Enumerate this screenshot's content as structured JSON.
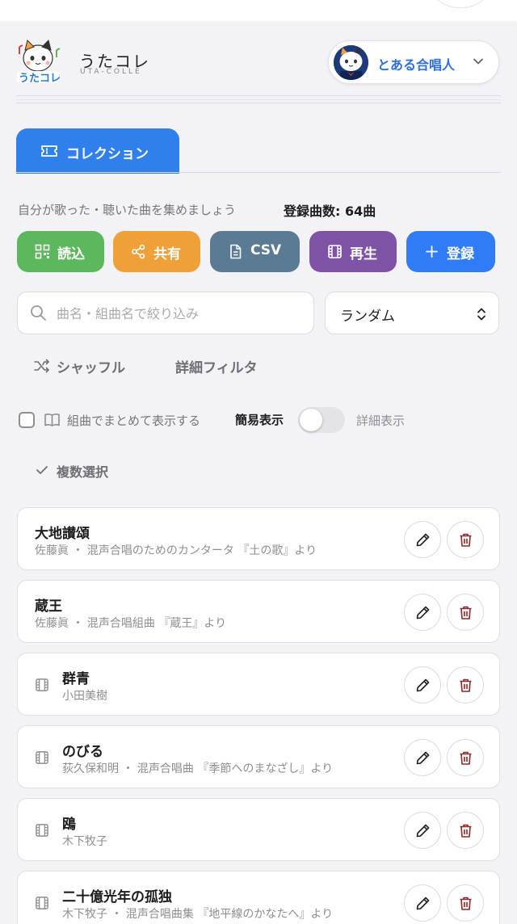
{
  "app": {
    "name": "うたコレ",
    "subtitle": "UTA-COLLE",
    "logo_text": "うたコレ"
  },
  "user": {
    "name": "とある合唱人"
  },
  "tab": {
    "label": "コレクション"
  },
  "intro": {
    "text": "自分が歌った・聴いた曲を集めましょう",
    "count": "登録曲数: 64曲"
  },
  "actions": {
    "read": "読込",
    "share": "共有",
    "csv": "CSV",
    "play": "再生",
    "add": "登録"
  },
  "search": {
    "placeholder": "曲名・組曲名で絞り込み"
  },
  "sort": {
    "selected": "ランダム"
  },
  "controls": {
    "shuffle": "シャッフル",
    "detail_filter": "詳細フィルタ",
    "group_by_suite": "組曲でまとめて表示する",
    "simple_view": "簡易表示",
    "detail_view": "詳細表示",
    "detail_view_on": false,
    "multi_select": "複数選択"
  },
  "songs": [
    {
      "title": "大地讃頌",
      "sub": "佐藤眞 ・ 混声合唱のためのカンタータ 『土の歌』より",
      "medley": false
    },
    {
      "title": "蔵王",
      "sub": "佐藤眞 ・ 混声合唱組曲 『蔵王』より",
      "medley": false
    },
    {
      "title": "群青",
      "sub": "小田美樹",
      "medley": true
    },
    {
      "title": "のびる",
      "sub": "荻久保和明 ・ 混声合唱曲 『季節へのまなざし』より",
      "medley": true
    },
    {
      "title": "鴎",
      "sub": "木下牧子",
      "medley": true
    },
    {
      "title": "二十億光年の孤独",
      "sub": "木下牧子 ・ 混声合唱曲集 『地平線のかなたへ』より",
      "medley": true
    }
  ],
  "colors": {
    "accent": "#2f80ed",
    "read": "#5cb85c",
    "share": "#f0a038",
    "csv": "#5b7b94",
    "play": "#7e52a6",
    "add": "#2f7cf6",
    "user_name": "#2d6fe0",
    "delete_icon": "#8b2a2a"
  },
  "icons": {
    "tab": "ticket-icon",
    "read": "qr-code-icon",
    "share": "share-icon",
    "csv": "file-icon",
    "play": "film-icon",
    "add": "plus-icon",
    "search": "search-icon",
    "sort": "updown-icon",
    "shuffle": "shuffle-icon",
    "group": "book-icon",
    "multi": "check-icon",
    "medley": "film-icon",
    "edit": "pencil-icon",
    "delete": "trash-icon",
    "user_menu": "chevron-down-icon"
  }
}
